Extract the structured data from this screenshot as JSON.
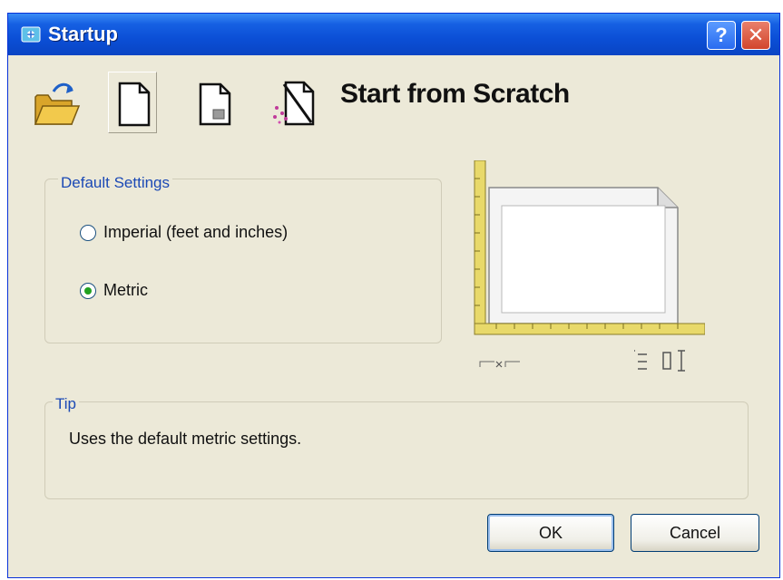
{
  "window": {
    "title": "Startup",
    "help_label": "?",
    "close_label": "✕"
  },
  "modes": [
    {
      "name": "Open a Drawing",
      "icon": "folder-open-icon",
      "selected": false
    },
    {
      "name": "Start from Scratch",
      "icon": "blank-page-icon",
      "selected": true
    },
    {
      "name": "Use a Template",
      "icon": "template-page-icon",
      "selected": false
    },
    {
      "name": "Use a Wizard",
      "icon": "wizard-icon",
      "selected": false
    }
  ],
  "heading": "Start from Scratch",
  "default_settings": {
    "legend": "Default Settings",
    "options": [
      {
        "label": "Imperial (feet and inches)",
        "checked": false
      },
      {
        "label": "Metric",
        "checked": true
      }
    ]
  },
  "tip": {
    "legend": "Tip",
    "text": "Uses the default metric settings."
  },
  "buttons": {
    "ok": "OK",
    "cancel": "Cancel"
  },
  "colors": {
    "titlebar": "#0b4fd6",
    "legend_text": "#1b49b5",
    "ruler": "#e8d96a",
    "radio_checked": "#21a121"
  }
}
